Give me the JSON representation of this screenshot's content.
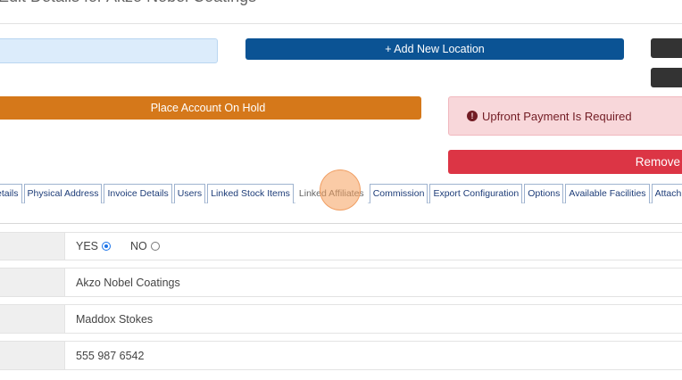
{
  "header": {
    "title": "Edit Details for Akzo Nobel Coatings"
  },
  "actions": {
    "add_location": "+ Add New Location",
    "place_on_hold": "Place Account On Hold",
    "remove": "Remove"
  },
  "alert": {
    "icon": "exclamation-circle-icon",
    "text": "Upfront Payment Is Required"
  },
  "tabs": [
    {
      "label": "etails"
    },
    {
      "label": "Physical Address"
    },
    {
      "label": "Invoice Details"
    },
    {
      "label": "Users"
    },
    {
      "label": "Linked Stock Items"
    },
    {
      "label": "Linked Affiliates"
    },
    {
      "label": "Commission"
    },
    {
      "label": "Export Configuration"
    },
    {
      "label": "Options"
    },
    {
      "label": "Available Facilities"
    },
    {
      "label": "Attachn"
    }
  ],
  "form": {
    "yes_label": "YES",
    "no_label": "NO",
    "selected": "YES",
    "company_name": "Akzo Nobel Coatings",
    "contact_name": "Maddox Stokes",
    "phone": "555 987 6542"
  },
  "colors": {
    "primary": "#0b5394",
    "warning": "#d5781a",
    "danger": "#dc3545",
    "alert_bg": "#f8d7da"
  }
}
